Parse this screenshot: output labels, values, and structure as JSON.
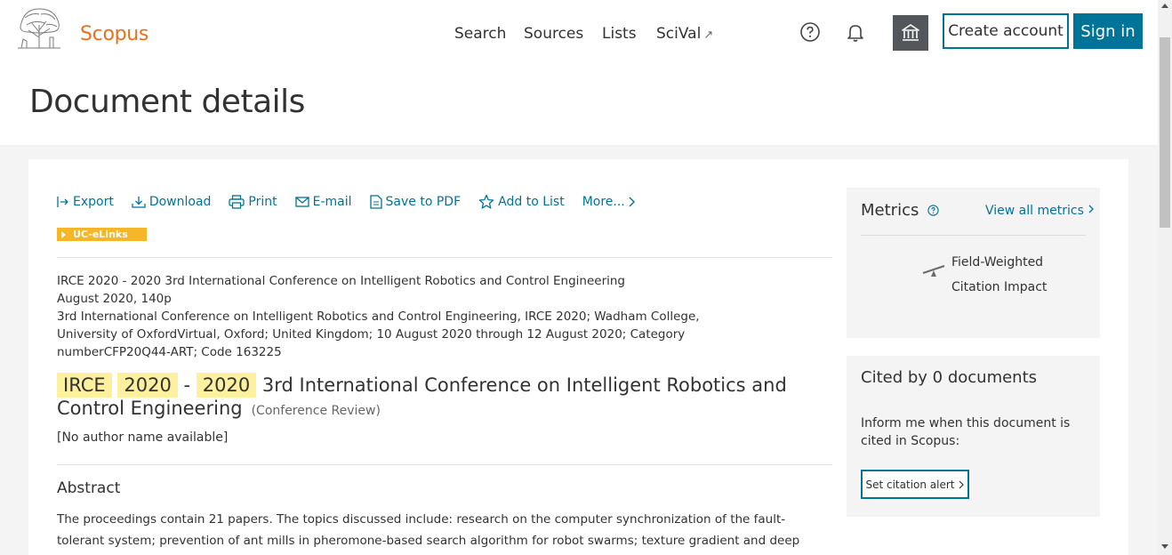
{
  "header": {
    "brand": "Scopus",
    "nav": [
      "Search",
      "Sources",
      "Lists",
      "SciVal"
    ],
    "scival_ext": "↗",
    "create_account": "Create account",
    "sign_in": "Sign in"
  },
  "page": {
    "title": "Document details"
  },
  "toolbar": {
    "items": [
      "Export",
      "Download",
      "Print",
      "E-mail",
      "Save to PDF",
      "Add to List",
      "More..."
    ]
  },
  "ucelinks": "UC-eLinks",
  "source_info": {
    "line1": "IRCE 2020 - 2020 3rd International Conference on Intelligent Robotics and Control Engineering",
    "line2": "August 2020, 140p",
    "line3": "3rd International Conference on Intelligent Robotics and Control Engineering, IRCE 2020; Wadham College, University of OxfordVirtual, Oxford; United Kingdom; 10 August 2020 through 12 August 2020; Category numberCFP20Q44-ART; Code 163225"
  },
  "document": {
    "title_parts": [
      "IRCE",
      "2020",
      "-",
      "2020",
      "3rd International Conference on Intelligent Robotics and Control Engineering"
    ],
    "type": "(Conference Review)",
    "authors": "[No author name available]"
  },
  "abstract": {
    "heading": "Abstract",
    "text": "The proceedings contain 21 papers. The topics discussed include: research on the computer synchronization of the fault-tolerant system; prevention of ant mills in pheromone-based search algorithm for robot swarms; texture gradient and deep features fusion-based"
  },
  "metrics": {
    "title": "Metrics",
    "view_all": "View all metrics",
    "fwci_line1": "Field-Weighted",
    "fwci_line2": "Citation Impact"
  },
  "cited": {
    "title": "Cited by 0 documents",
    "inform": "Inform me when this document is cited in Scopus:",
    "alert_button": "Set citation alert"
  },
  "colors": {
    "accent": "#007398",
    "brand": "#e9711c",
    "highlight": "#fdf09e",
    "ucelinks": "#f5b62a"
  }
}
